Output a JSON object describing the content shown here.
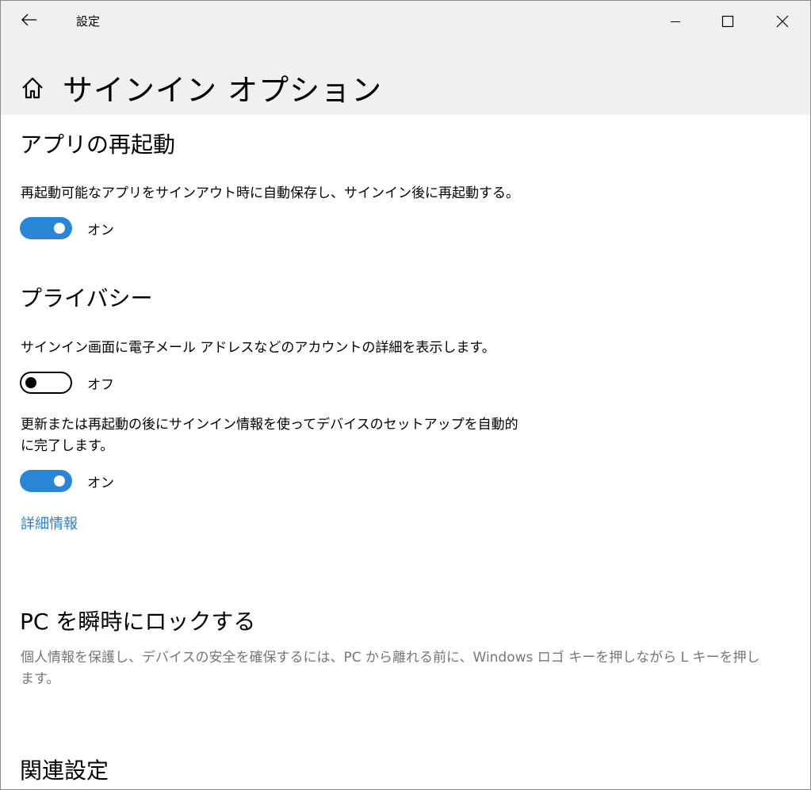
{
  "window": {
    "app_title": "設定",
    "back_icon": "back-arrow-icon",
    "minimize_icon": "minimize-icon",
    "maximize_icon": "maximize-icon",
    "close_icon": "close-icon"
  },
  "header": {
    "home_icon": "home-icon",
    "title": "サインイン オプション"
  },
  "sections": {
    "app_restart": {
      "title": "アプリの再起動",
      "description": "再起動可能なアプリをサインアウト時に自動保存し、サインイン後に再起動する。",
      "toggle_state": "on",
      "toggle_label": "オン"
    },
    "privacy": {
      "title": "プライバシー",
      "account_details": {
        "description": "サインイン画面に電子メール アドレスなどのアカウントの詳細を表示します。",
        "toggle_state": "off",
        "toggle_label": "オフ"
      },
      "auto_setup": {
        "description_line1": "更新または再起動の後にサインイン情報を使ってデバイスのセットアップを自動的",
        "description_line2": "に完了します。",
        "toggle_state": "on",
        "toggle_label": "オン"
      },
      "more_info_link": "詳細情報"
    },
    "lock_pc": {
      "title": "PC を瞬時にロックする",
      "description_line1": "個人情報を保護し、デバイスの安全を確保するには、PC から離れる前に、Windows ロゴ キーを押しながら L キーを押し",
      "description_line2": "ます。"
    },
    "related": {
      "title": "関連設定"
    }
  },
  "colors": {
    "accent": "#2a85d4",
    "link": "#2a7fc4",
    "header_bg": "#f0f0f0",
    "muted_text": "#767676"
  }
}
